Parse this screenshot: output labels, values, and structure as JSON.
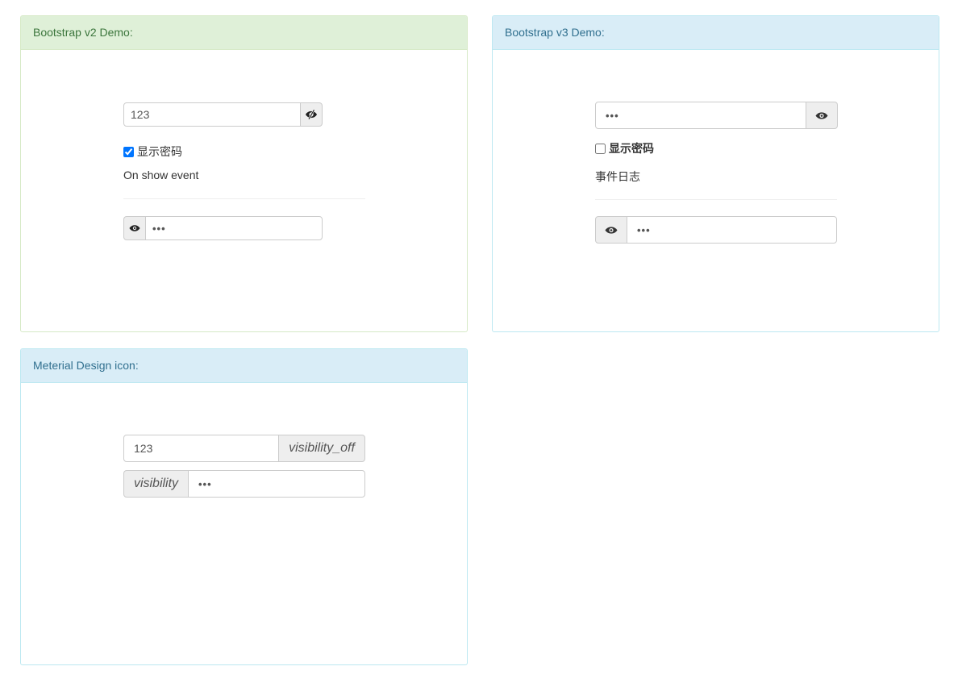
{
  "v2": {
    "title": "Bootstrap v2 Demo:",
    "password_visible_value": "123",
    "show_password_label": "显示密码",
    "show_password_checked": true,
    "event_text": "On show event",
    "password_hidden_value": "•••"
  },
  "v3": {
    "title": "Bootstrap v3 Demo:",
    "password_hidden_value": "•••",
    "show_password_label": "显示密码",
    "show_password_checked": false,
    "event_text": "事件日志",
    "password_hidden_value_2": "•••"
  },
  "md": {
    "title": "Meterial Design icon:",
    "password_visible_value": "123",
    "visibility_off_label": "visibility_off",
    "visibility_label": "visibility",
    "password_hidden_value": "•••"
  },
  "icons": {
    "eye": "eye-icon",
    "eye_slash": "eye-slash-icon"
  },
  "colors": {
    "success_heading_bg": "#dff0d8",
    "success_heading_text": "#3c763d",
    "info_heading_bg": "#d9edf7",
    "info_heading_text": "#31708f"
  }
}
